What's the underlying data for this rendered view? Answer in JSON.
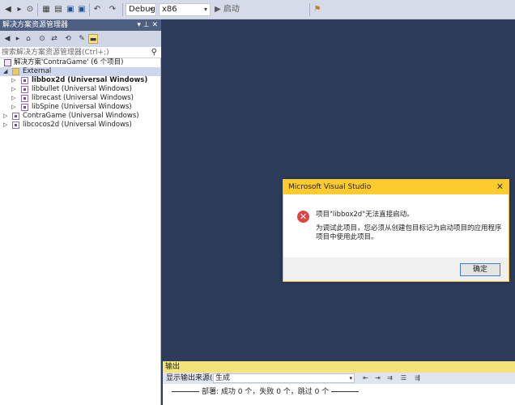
{
  "toolbar": {
    "config": "Debug",
    "platform": "x86",
    "start_label": "▶ 启动"
  },
  "solution_explorer": {
    "title": "解决方案资源管理器",
    "title_controls": "▾ ⊥ ✕",
    "search_placeholder": "搜索解决方案资源管理器(Ctrl+;)",
    "tree": [
      {
        "label": "解决方案'ContraGame' (6 个项目)"
      },
      {
        "label": "External"
      },
      {
        "label": "libbox2d (Universal Windows)"
      },
      {
        "label": "libbullet (Universal Windows)"
      },
      {
        "label": "librecast (Universal Windows)"
      },
      {
        "label": "libSpine (Universal Windows)"
      },
      {
        "label": "ContraGame (Universal Windows)"
      },
      {
        "label": "libcocos2d (Universal Windows)"
      }
    ]
  },
  "output": {
    "title": "输出",
    "source_label": "显示输出来源(S):",
    "source_value": "生成",
    "text": "部署: 成功 0 个，失败 0 个，跳过 0 个"
  },
  "dialog": {
    "title": "Microsoft Visual Studio",
    "close": "✕",
    "message": "项目\"libbox2d\"无法直接启动。",
    "detail": "为调试此项目，您必须从创建包目标记为启动项目的应用程序项目中使用此项目。",
    "ok": "确定"
  },
  "colors": {
    "editor_bg": "#2d3c5b",
    "dialog_title": "#fccb2e",
    "error_icon": "#e04343",
    "output_title": "#f3e37a"
  }
}
